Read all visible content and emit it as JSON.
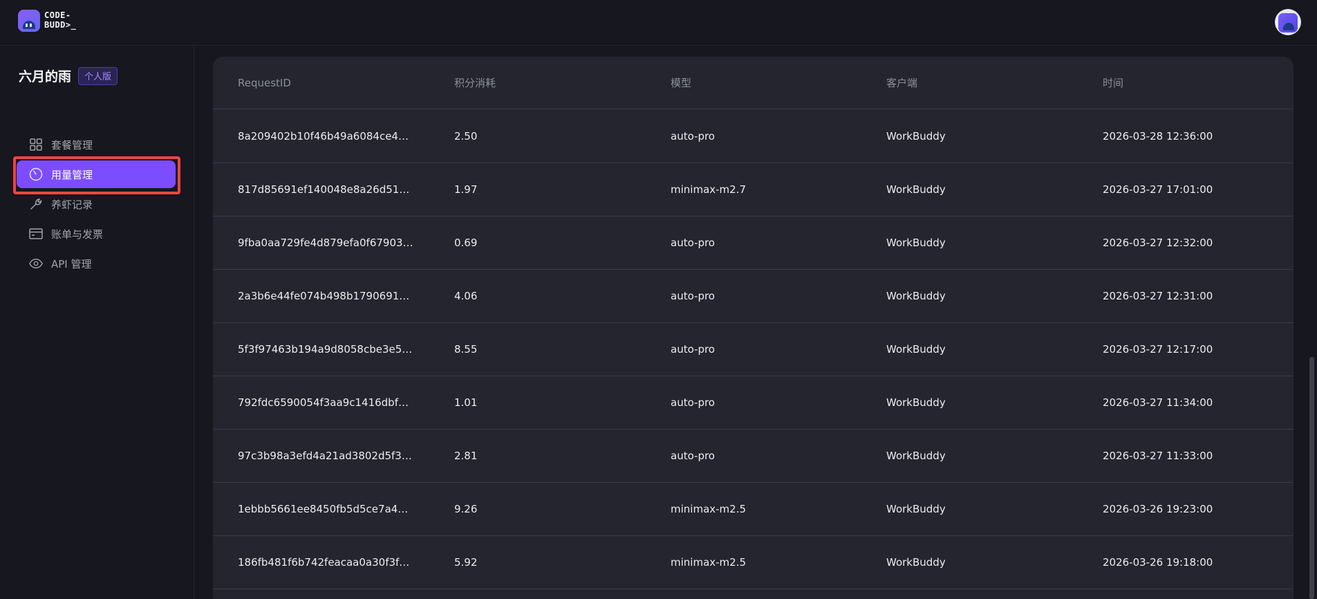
{
  "header": {
    "brand_line1": "CODE-",
    "brand_line2": "BUDD>_"
  },
  "sidebar": {
    "org_name": "六月的雨",
    "org_badge": "个人版",
    "items": [
      {
        "label": "套餐管理",
        "icon": "grid-icon",
        "active": false
      },
      {
        "label": "用量管理",
        "icon": "gauge-icon",
        "active": true
      },
      {
        "label": "养虾记录",
        "icon": "wrench-icon",
        "active": false
      },
      {
        "label": "账单与发票",
        "icon": "card-icon",
        "active": false
      },
      {
        "label": "API 管理",
        "icon": "eye-icon",
        "active": false
      }
    ]
  },
  "table": {
    "columns": [
      "RequestID",
      "积分消耗",
      "模型",
      "客户端",
      "时间"
    ],
    "rows": [
      [
        "8a209402b10f46b49a6084ce4…",
        "2.50",
        "auto-pro",
        "WorkBuddy",
        "2026-03-28 12:36:00"
      ],
      [
        "817d85691ef140048e8a26d51…",
        "1.97",
        "minimax-m2.7",
        "WorkBuddy",
        "2026-03-27 17:01:00"
      ],
      [
        "9fba0aa729fe4d879efa0f67903…",
        "0.69",
        "auto-pro",
        "WorkBuddy",
        "2026-03-27 12:32:00"
      ],
      [
        "2a3b6e44fe074b498b1790691…",
        "4.06",
        "auto-pro",
        "WorkBuddy",
        "2026-03-27 12:31:00"
      ],
      [
        "5f3f97463b194a9d8058cbe3e5…",
        "8.55",
        "auto-pro",
        "WorkBuddy",
        "2026-03-27 12:17:00"
      ],
      [
        "792fdc6590054f3aa9c1416dbf…",
        "1.01",
        "auto-pro",
        "WorkBuddy",
        "2026-03-27 11:34:00"
      ],
      [
        "97c3b98a3efd4a21ad3802d5f3…",
        "2.81",
        "auto-pro",
        "WorkBuddy",
        "2026-03-27 11:33:00"
      ],
      [
        "1ebbb5661ee8450fb5d5ce7a4…",
        "9.26",
        "minimax-m2.5",
        "WorkBuddy",
        "2026-03-26 19:23:00"
      ],
      [
        "186fb481f6b742feacaa0a30f3f…",
        "5.92",
        "minimax-m2.5",
        "WorkBuddy",
        "2026-03-26 19:18:00"
      ]
    ]
  },
  "colors": {
    "accent": "#7c4dff",
    "highlight_outline": "#ef4444",
    "background": "#16171f",
    "panel": "#24252f"
  }
}
